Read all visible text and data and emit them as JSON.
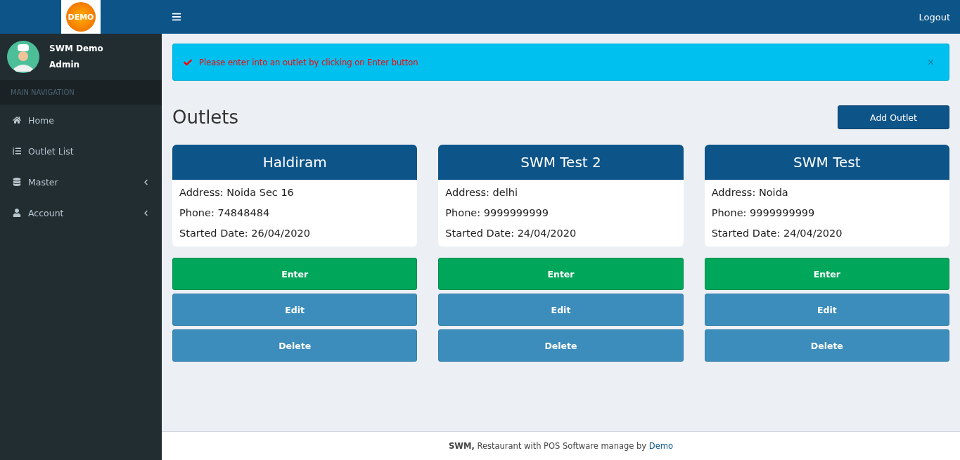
{
  "header": {
    "logo": "DEMO",
    "logout": "Logout"
  },
  "sidebar": {
    "user": {
      "name": "SWM Demo",
      "role": "Admin"
    },
    "section": "MAIN NAVIGATION",
    "items": [
      {
        "label": "Home",
        "expandable": false
      },
      {
        "label": "Outlet List",
        "expandable": false
      },
      {
        "label": "Master",
        "expandable": true
      },
      {
        "label": "Account",
        "expandable": true
      }
    ]
  },
  "alert": {
    "message": "Please enter into an outlet by clicking on Enter button",
    "close": "×"
  },
  "page": {
    "title": "Outlets",
    "add_button": "Add Outlet"
  },
  "outlets": [
    {
      "name": "Haldiram",
      "address": "Address: Noida Sec 16",
      "phone": "Phone: 74848484",
      "started": "Started Date: 26/04/2020",
      "actions": [
        "Enter",
        "Edit",
        "Delete"
      ]
    },
    {
      "name": "SWM Test 2",
      "address": "Address: delhi",
      "phone": "Phone: 9999999999",
      "started": "Started Date: 24/04/2020",
      "actions": [
        "Enter",
        "Edit",
        "Delete"
      ]
    },
    {
      "name": "SWM Test",
      "address": "Address: Noida",
      "phone": "Phone: 9999999999",
      "started": "Started Date: 24/04/2020",
      "actions": [
        "Enter",
        "Edit",
        "Delete"
      ]
    }
  ],
  "footer": {
    "text": "**SWM,** Restaurant with POS Software manage by ",
    "link": "Demo"
  }
}
